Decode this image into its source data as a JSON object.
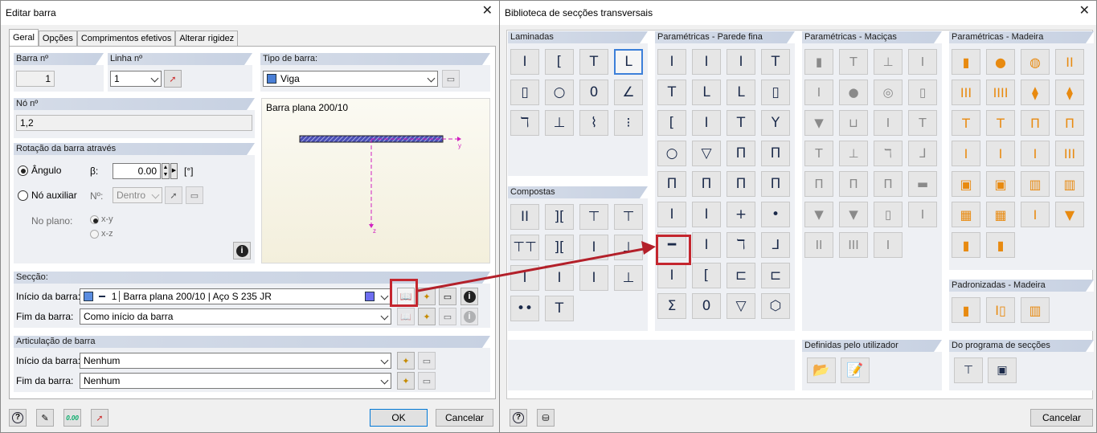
{
  "left_dialog": {
    "title": "Editar barra",
    "tabs": [
      "Geral",
      "Opções",
      "Comprimentos efetivos",
      "Alterar rigidez"
    ],
    "barra_n": {
      "label": "Barra nº",
      "value": "1"
    },
    "linha_n": {
      "label": "Linha nº",
      "value": "1"
    },
    "tipo_barra": {
      "label": "Tipo de barra:",
      "value": "Viga",
      "color": "#4a7fd6"
    },
    "no_n": {
      "label": "Nó nº",
      "value": "1,2"
    },
    "preview_title": "Barra plana 200/10",
    "preview_axes": {
      "y": "y",
      "z": "z"
    },
    "rotacao": {
      "label": "Rotação da barra através",
      "angulo": "Ângulo",
      "beta_label": "β:",
      "beta_value": "0.00",
      "unit": "[°]",
      "no_auxiliar": "Nó auxiliar",
      "n_label": "Nº:",
      "n_value": "Dentro",
      "no_plano": "No plano:",
      "xy": "x-y",
      "xz": "x-z"
    },
    "seccao": {
      "label": "Secção:",
      "inicio_label": "Início da barra:",
      "inicio_value_num": "1",
      "inicio_value_text": "Barra plana 200/10  |  Aço S 235 JR",
      "fim_label": "Fim da barra:",
      "fim_value": "Como início da barra"
    },
    "articulacao": {
      "label": "Articulação de barra",
      "inicio_label": "Início da barra:",
      "inicio_value": "Nenhum",
      "fim_label": "Fim da barra:",
      "fim_value": "Nenhum"
    },
    "ok": "OK",
    "cancel": "Cancelar"
  },
  "right_dialog": {
    "title": "Biblioteca de secções transversais",
    "groups": {
      "laminadas": "Laminadas",
      "param_fina": "Paramétricas - Parede fina",
      "param_macicas": "Paramétricas - Maciças",
      "param_madeira": "Paramétricas - Madeira",
      "compostas": "Compostas",
      "padronizadas": "Padronizadas - Madeira",
      "definidas": "Definidas pelo utilizador",
      "programa": "Do programa de secções"
    },
    "laminadas_icons": [
      "I",
      "[",
      "T",
      "L",
      "▯",
      "○",
      "0",
      "∠",
      "ℸ",
      "⊥",
      "⌇",
      "⁝"
    ],
    "compostas_icons": [
      "II",
      "][",
      "⊤",
      "⊤",
      "⊤⊤",
      "][",
      "I",
      "⊥",
      "I",
      "I",
      "I",
      "⊥",
      "••",
      "T"
    ],
    "fina_icons": [
      "I",
      "I",
      "I",
      "T",
      "T",
      "L",
      "L",
      "▯",
      "[",
      "I",
      "T",
      "Y",
      "○",
      "▽",
      "Π",
      "Π",
      "Π",
      "Π",
      "Π",
      "Π",
      "I",
      "I",
      "+",
      "•",
      "━",
      "I",
      "ℸ",
      "ᒧ",
      "I",
      "[",
      "⊏",
      "⊏",
      "Σ",
      "0",
      "▽",
      "⬡"
    ],
    "macicas_icons": [
      "▮",
      "T",
      "⊥",
      "I",
      "I",
      "●",
      "◎",
      "▯",
      "▼",
      "⊔",
      "I",
      "T",
      "T",
      "⊥",
      "ℸ",
      "ᒧ",
      "Π",
      "Π",
      "Π",
      "▬",
      "▼",
      "▼",
      "▯",
      "I",
      "II",
      "III",
      "I"
    ],
    "madeira_icons": [
      "▮",
      "●",
      "◍",
      "II",
      "III",
      "IIII",
      "⧫",
      "⧫",
      "T",
      "T",
      "Π",
      "Π",
      "I",
      "I",
      "I",
      "III",
      "▣",
      "▣",
      "▥",
      "▥",
      "▦",
      "▦",
      "I",
      "▼",
      "▮",
      "▮"
    ],
    "padronizadas_icons": [
      "▮",
      "I▯",
      "▥"
    ],
    "cancel": "Cancelar"
  }
}
